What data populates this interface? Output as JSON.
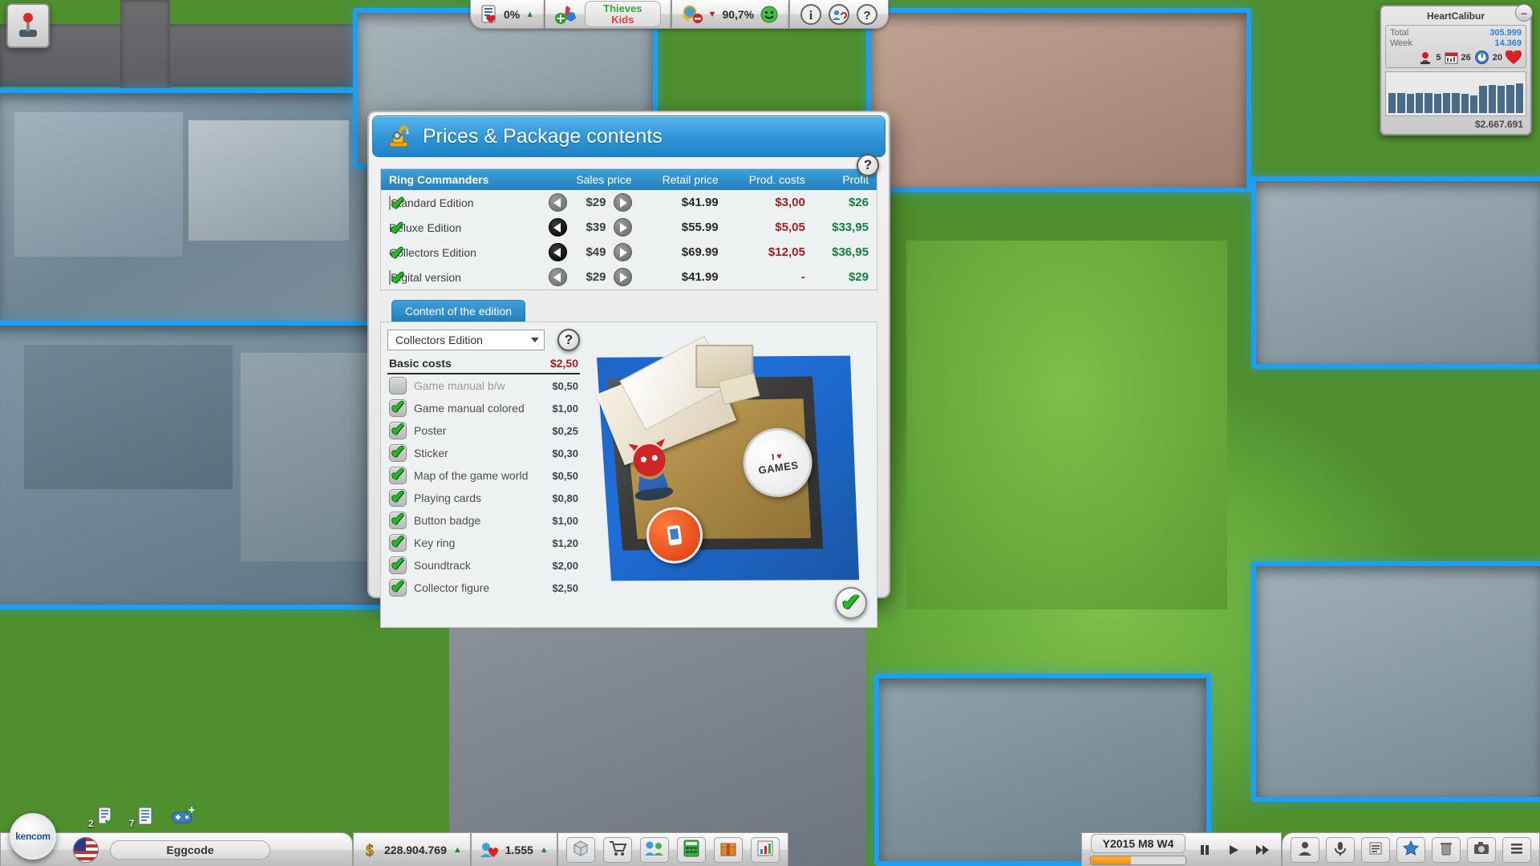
{
  "top_hud": {
    "research_percent": "0%",
    "research_trend": "▲",
    "genre_primary": "Thieves",
    "genre_secondary": "Kids",
    "satisfaction": "90,7%",
    "satisfaction_trend": "▼",
    "icons": [
      "report-heart-icon",
      "puzzle-add-icon",
      "magnifier-minus-icon",
      "smiley-icon",
      "info-icon",
      "help-people-icon",
      "question-icon"
    ]
  },
  "company_panel": {
    "title": "HeartCalibur",
    "total_label": "Total",
    "total_value": "305.999",
    "week_label": "Week",
    "week_value": "14.369",
    "rating_awards": "5",
    "rating_days": "26",
    "rating_hearts": "20",
    "grand_total": "$2.667.691",
    "chart_bars": [
      52,
      53,
      50,
      53,
      52,
      51,
      52,
      52,
      50,
      47,
      72,
      74,
      72,
      73,
      77
    ]
  },
  "dialog": {
    "title": "Prices & Package contents",
    "title_icon": "crane-icon",
    "help_icon": "question-mark-icon",
    "confirm_icon": "green-check-icon"
  },
  "price_table": {
    "columns": [
      "Ring Commanders",
      "Sales price",
      "Retail price",
      "Prod. costs",
      "Profit"
    ],
    "rows": [
      {
        "enabled": true,
        "boxed": true,
        "name": "Standard Edition",
        "sales_price": "$29",
        "retail_price": "$41.99",
        "prod_costs": "$3,00",
        "profit": "$26",
        "left_active": false
      },
      {
        "enabled": true,
        "boxed": false,
        "name": "Deluxe Edition",
        "sales_price": "$39",
        "retail_price": "$55.99",
        "prod_costs": "$5,05",
        "profit": "$33,95",
        "left_active": true
      },
      {
        "enabled": true,
        "boxed": false,
        "name": "Collectors Edition",
        "sales_price": "$49",
        "retail_price": "$69.99",
        "prod_costs": "$12,05",
        "profit": "$36,95",
        "left_active": true
      },
      {
        "enabled": true,
        "boxed": true,
        "name": "Digital version",
        "sales_price": "$29",
        "retail_price": "$41.99",
        "prod_costs": "-",
        "profit": "$29",
        "left_active": false
      }
    ]
  },
  "content_section": {
    "tab_label": "Content of the edition",
    "selected_edition": "Collectors Edition",
    "basic_costs_label": "Basic costs",
    "basic_costs_value": "$2,50",
    "help_icon": "question-mark-icon",
    "items": [
      {
        "checked": false,
        "name": "Game manual b/w",
        "price": "$0,50"
      },
      {
        "checked": true,
        "name": "Game manual colored",
        "price": "$1,00"
      },
      {
        "checked": true,
        "name": "Poster",
        "price": "$0,25"
      },
      {
        "checked": true,
        "name": "Sticker",
        "price": "$0,30"
      },
      {
        "checked": true,
        "name": "Map of the game world",
        "price": "$0,50"
      },
      {
        "checked": true,
        "name": "Playing cards",
        "price": "$0,80"
      },
      {
        "checked": true,
        "name": "Button badge",
        "price": "$1,00"
      },
      {
        "checked": true,
        "name": "Key ring",
        "price": "$1,20"
      },
      {
        "checked": true,
        "name": "Soundtrack",
        "price": "$2,00"
      },
      {
        "checked": true,
        "name": "Collector figure",
        "price": "$2,50"
      }
    ],
    "preview_labels": {
      "badge_text": "I ♥ GAMES"
    }
  },
  "bottom_bar": {
    "player_name": "Eggcode",
    "money": "228.904.769",
    "money_trend": "▲",
    "fans": "1.555",
    "fans_trend": "▲",
    "date": "Y2015 M8 W4",
    "tools": [
      "cube-icon",
      "cart-icon",
      "people-icon",
      "calculator-icon",
      "gift-icon",
      "chart-icon"
    ],
    "transport_icons": [
      "pause-icon",
      "play-icon",
      "fast-forward-icon"
    ],
    "right_icons": [
      "person-icon",
      "microphone-icon",
      "list-icon",
      "star-icon",
      "trash-icon",
      "camera-icon",
      "menu-icon"
    ],
    "mini_badges": [
      {
        "count": "2",
        "icon": "document-check-icon"
      },
      {
        "count": "7",
        "icon": "document-icon"
      },
      {
        "count": "",
        "icon": "gamepad-add-icon"
      }
    ],
    "speed_fill_percent": 42
  },
  "colors": {
    "accent_blue": "#2480bd",
    "header_blue": "#3f9fd8",
    "profit_green": "#128040",
    "cost_red": "#a02020",
    "plot_outline": "#1ca0f5"
  }
}
